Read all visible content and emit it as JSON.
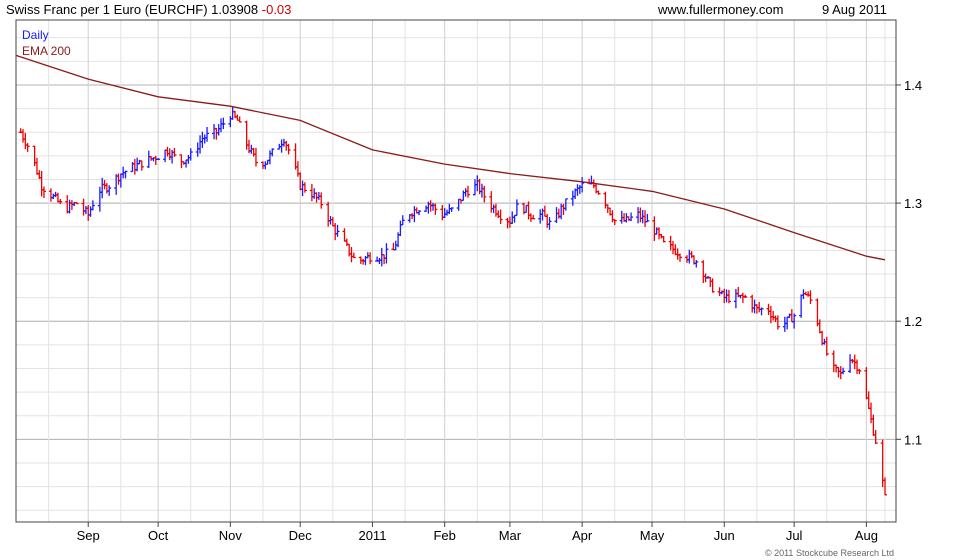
{
  "header": {
    "title_prefix": "Swiss Franc per 1 Euro (EURCHF) 1.03908 ",
    "change": "-0.03",
    "site": "www.fullermoney.com",
    "date": "9 Aug 2011"
  },
  "copyright": "© 2011 Stockcube Research Ltd",
  "colors": {
    "up": "#1a1aff",
    "down": "#ee0000",
    "ema": "#8b1a1a",
    "grid_major": "#b3b3b3",
    "grid_minor": "#e3e3e3"
  },
  "chart_data": {
    "type": "line",
    "subtype": "ohlc-bars",
    "legend": [
      "Daily",
      "EMA 200"
    ],
    "legend_position": "top-left",
    "ylim": [
      1.03,
      1.455
    ],
    "yticks": [
      1.1,
      1.2,
      1.3,
      1.4
    ],
    "ytick_labels": [
      "1.1",
      "1.2",
      "1.3",
      "1.4"
    ],
    "x_dates": [
      "2010-08-01",
      "2010-08-15",
      "2010-09-01",
      "2010-09-15",
      "2010-10-01",
      "2010-10-15",
      "2010-11-01",
      "2010-11-15",
      "2010-12-01",
      "2010-12-15",
      "2011-01-01",
      "2011-01-15",
      "2011-02-01",
      "2011-02-15",
      "2011-03-01",
      "2011-03-15",
      "2011-04-01",
      "2011-04-15",
      "2011-05-01",
      "2011-05-15",
      "2011-06-01",
      "2011-06-15",
      "2011-07-01",
      "2011-07-15",
      "2011-08-01",
      "2011-08-09"
    ],
    "month_ticks": [
      "Sep",
      "Oct",
      "Nov",
      "Dec",
      "2011",
      "Feb",
      "Mar",
      "Apr",
      "May",
      "Jun",
      "Jul",
      "Aug"
    ],
    "series": [
      {
        "name": "Daily",
        "type": "ohlc",
        "points": [
          [
            "2010-08-03",
            1.36
          ],
          [
            "2010-08-07",
            1.345
          ],
          [
            "2010-08-12",
            1.315
          ],
          [
            "2010-08-17",
            1.305
          ],
          [
            "2010-08-22",
            1.295
          ],
          [
            "2010-08-27",
            1.3
          ],
          [
            "2010-09-01",
            1.29
          ],
          [
            "2010-09-05",
            1.31
          ],
          [
            "2010-09-10",
            1.315
          ],
          [
            "2010-09-15",
            1.325
          ],
          [
            "2010-09-20",
            1.33
          ],
          [
            "2010-09-25",
            1.335
          ],
          [
            "2010-10-01",
            1.34
          ],
          [
            "2010-10-05",
            1.345
          ],
          [
            "2010-10-10",
            1.335
          ],
          [
            "2010-10-15",
            1.34
          ],
          [
            "2010-10-20",
            1.355
          ],
          [
            "2010-10-26",
            1.36
          ],
          [
            "2010-11-01",
            1.375
          ],
          [
            "2010-11-04",
            1.37
          ],
          [
            "2010-11-08",
            1.35
          ],
          [
            "2010-11-12",
            1.335
          ],
          [
            "2010-11-16",
            1.335
          ],
          [
            "2010-11-20",
            1.345
          ],
          [
            "2010-11-24",
            1.355
          ],
          [
            "2010-11-27",
            1.34
          ],
          [
            "2010-12-01",
            1.315
          ],
          [
            "2010-12-05",
            1.31
          ],
          [
            "2010-12-10",
            1.3
          ],
          [
            "2010-12-15",
            1.28
          ],
          [
            "2010-12-20",
            1.265
          ],
          [
            "2010-12-25",
            1.25
          ],
          [
            "2010-12-31",
            1.255
          ],
          [
            "2011-01-05",
            1.255
          ],
          [
            "2011-01-10",
            1.26
          ],
          [
            "2011-01-15",
            1.29
          ],
          [
            "2011-01-20",
            1.295
          ],
          [
            "2011-01-25",
            1.3
          ],
          [
            "2011-01-31",
            1.29
          ],
          [
            "2011-02-05",
            1.295
          ],
          [
            "2011-02-10",
            1.31
          ],
          [
            "2011-02-15",
            1.315
          ],
          [
            "2011-02-20",
            1.3
          ],
          [
            "2011-02-25",
            1.29
          ],
          [
            "2011-03-01",
            1.285
          ],
          [
            "2011-03-05",
            1.3
          ],
          [
            "2011-03-10",
            1.29
          ],
          [
            "2011-03-15",
            1.29
          ],
          [
            "2011-03-19",
            1.28
          ],
          [
            "2011-03-23",
            1.295
          ],
          [
            "2011-03-27",
            1.305
          ],
          [
            "2011-04-01",
            1.315
          ],
          [
            "2011-04-06",
            1.315
          ],
          [
            "2011-04-10",
            1.305
          ],
          [
            "2011-04-15",
            1.285
          ],
          [
            "2011-04-20",
            1.285
          ],
          [
            "2011-04-25",
            1.29
          ],
          [
            "2011-05-01",
            1.28
          ],
          [
            "2011-05-06",
            1.265
          ],
          [
            "2011-05-11",
            1.26
          ],
          [
            "2011-05-16",
            1.255
          ],
          [
            "2011-05-21",
            1.25
          ],
          [
            "2011-05-26",
            1.23
          ],
          [
            "2011-06-01",
            1.22
          ],
          [
            "2011-06-06",
            1.22
          ],
          [
            "2011-06-10",
            1.22
          ],
          [
            "2011-06-15",
            1.21
          ],
          [
            "2011-06-20",
            1.21
          ],
          [
            "2011-06-25",
            1.195
          ],
          [
            "2011-07-01",
            1.205
          ],
          [
            "2011-07-05",
            1.225
          ],
          [
            "2011-07-09",
            1.215
          ],
          [
            "2011-07-13",
            1.185
          ],
          [
            "2011-07-17",
            1.16
          ],
          [
            "2011-07-21",
            1.155
          ],
          [
            "2011-07-25",
            1.17
          ],
          [
            "2011-07-29",
            1.16
          ],
          [
            "2011-08-02",
            1.125
          ],
          [
            "2011-08-06",
            1.09
          ],
          [
            "2011-08-09",
            1.05
          ]
        ]
      },
      {
        "name": "EMA 200",
        "type": "line",
        "points": [
          [
            "2010-08-01",
            1.425
          ],
          [
            "2010-09-01",
            1.405
          ],
          [
            "2010-10-01",
            1.39
          ],
          [
            "2010-11-01",
            1.382
          ],
          [
            "2010-12-01",
            1.37
          ],
          [
            "2011-01-01",
            1.345
          ],
          [
            "2011-02-01",
            1.333
          ],
          [
            "2011-03-01",
            1.325
          ],
          [
            "2011-04-01",
            1.318
          ],
          [
            "2011-05-01",
            1.31
          ],
          [
            "2011-06-01",
            1.295
          ],
          [
            "2011-07-01",
            1.275
          ],
          [
            "2011-08-01",
            1.255
          ],
          [
            "2011-08-09",
            1.252
          ]
        ]
      }
    ]
  }
}
